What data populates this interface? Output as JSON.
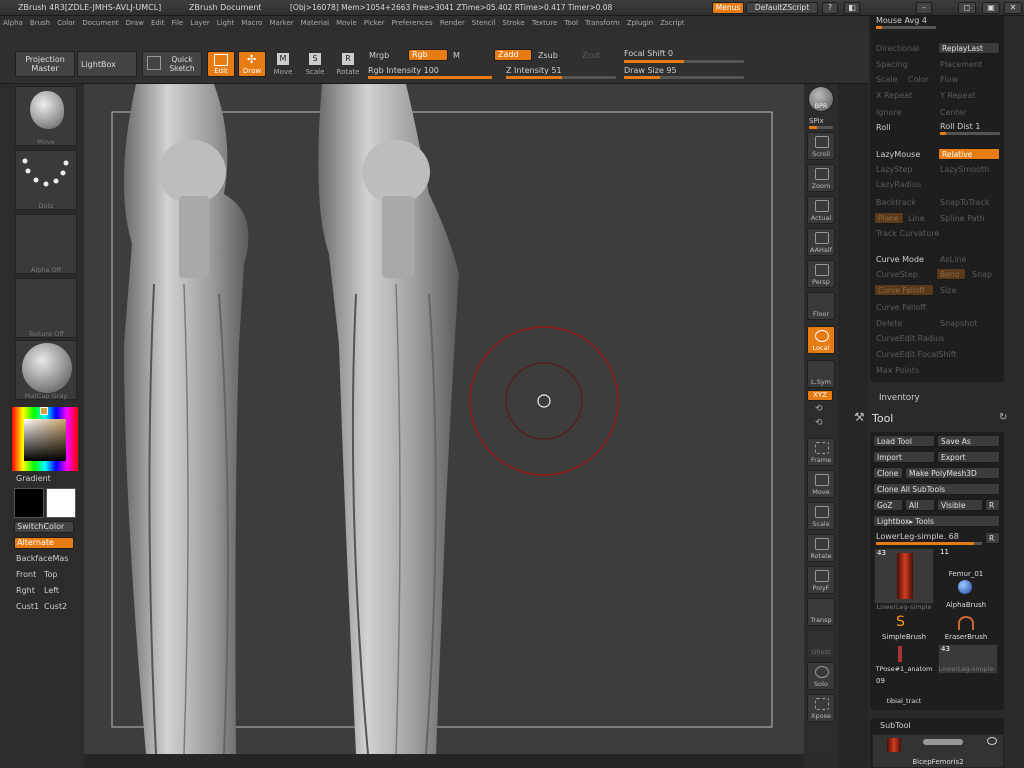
{
  "title": {
    "app": "ZBrush 4R3[ZDLE-JMHS-AVLJ-UMCL]",
    "document": "ZBrush Document",
    "stats": "[Obj>16078] Mem>1054+2663 Free>3041 ZTime>05.402 RTime>0.417 Timer>0.08",
    "menus_btn": "Menus",
    "script_btn": "DefaultZScript"
  },
  "menubar": [
    "Alpha",
    "Brush",
    "Color",
    "Document",
    "Draw",
    "Edit",
    "File",
    "Layer",
    "Light",
    "Macro",
    "Marker",
    "Material",
    "Movie",
    "Picker",
    "Preferences",
    "Render",
    "Stencil",
    "Stroke",
    "Texture",
    "Tool",
    "Transform",
    "Zplugin",
    "Zscript"
  ],
  "shelf": {
    "projection_master": "Projection Master",
    "lightbox": "LightBox",
    "quick_sketch": "Quick Sketch",
    "edit": "Edit",
    "draw": "Draw",
    "move": "Move",
    "scale": "Scale",
    "rotate": "Rotate",
    "mrgb": "Mrgb",
    "rgb": "Rgb",
    "m": "M",
    "zadd": "Zadd",
    "zsub": "Zsub",
    "zcut": "Zcut",
    "rgb_intensity": "Rgb Intensity 100",
    "z_intensity": "Z Intensity 51",
    "focal_shift": "Focal Shift 0",
    "draw_size": "Draw Size 95",
    "rgb_intensity_level": 1.0,
    "z_intensity_level": 0.51,
    "focal_shift_level": 0.5,
    "draw_size_level": 0.3
  },
  "left": {
    "brush": "Move",
    "stroke": "Dots",
    "alpha": "Alpha Off",
    "texture": "Texture Off",
    "material": "MatCap Gray",
    "gradient": "Gradient",
    "switchcolor": "SwitchColor",
    "alternate": "Alternate",
    "backface": "BackfaceMas",
    "front": "Front",
    "top": "Top",
    "rght": "Rght",
    "left": "Left",
    "cust1": "Cust1",
    "cust2": "Cust2"
  },
  "right_shelf": {
    "bpr": "BPR",
    "spix": "SPix",
    "scroll": "Scroll",
    "zoom": "Zoom",
    "actual": "Actual",
    "aahalf": "AAHalf",
    "persp": "Persp",
    "floor": "Floor",
    "local": "Local",
    "lsym": "L.Sym",
    "xyz": "XYZ",
    "frame": "Frame",
    "move": "Move",
    "scale": "Scale",
    "rotate": "Rotate",
    "polyf": "PolyF",
    "transp": "Transp",
    "ghost": "Ghost",
    "solo": "Solo",
    "xpose": "Xpose"
  },
  "stroke_panel": {
    "mouse_avg": "Mouse Avg 4",
    "directional": "Directional",
    "replaylast": "ReplayLast",
    "spacing": "Spacing",
    "placement": "Placement",
    "scale": "Scale",
    "color": "Color",
    "flow": "Flow",
    "x_repeat": "X Repeat",
    "y_repeat": "Y Repeat",
    "ignore": "Ignore",
    "center": "Center",
    "roll": "Roll",
    "roll_dist": "Roll Dist 1",
    "lazymouse": "LazyMouse",
    "relative": "Relative",
    "lazystep": "LazyStep",
    "lazysmooth": "LazySmooth",
    "lazyradius": "LazyRadius",
    "backtrack": "Backtrack",
    "snaptotrack": "SnapToTrack",
    "plane": "Plane",
    "line": "Line",
    "spline_path": "Spline Path",
    "track_curvature": "Track Curvature",
    "curve_mode": "Curve Mode",
    "as_line": "AsLine",
    "curve_step": "CurveStep",
    "bend": "Bend",
    "snap": "Snap",
    "curve_falloff_btn": "Curve Falloff",
    "size": "Size",
    "curve_falloff": "Curve Falloff",
    "delete": "Delete",
    "snapshot": "Snapshot",
    "curveedit_radius": "CurveEdit Radius",
    "curveedit_focalshift": "CurveEdit FocalShift",
    "max_points": "Max Points"
  },
  "inventory": "Inventory",
  "tool_panel": {
    "title": "Tool",
    "load_tool": "Load Tool",
    "save_as": "Save As",
    "import": "Import",
    "export": "Export",
    "clone": "Clone",
    "make_polymesh": "Make PolyMesh3D",
    "clone_all": "Clone All SubTools",
    "goz": "GoZ",
    "all": "All",
    "visible": "Visible",
    "r": "R",
    "lightbox_tools": "Lightbox▸ Tools",
    "current_tool": "LowerLeg-simple. 68",
    "tools": [
      {
        "name": "LowerLeg-simple",
        "count": "43"
      },
      {
        "name": "Femur_01",
        "count": "11"
      },
      {
        "name": "AlphaBrush",
        "count": ""
      },
      {
        "name": "SimpleBrush",
        "count": ""
      },
      {
        "name": "EraserBrush",
        "count": ""
      },
      {
        "name": "TPose#1_anatom",
        "count": ""
      },
      {
        "name": "LowerLeg-simple",
        "count": "43"
      },
      {
        "name": "tibial_tract",
        "count": "09"
      }
    ]
  },
  "subtool": {
    "title": "SubTool",
    "item": "BicepFemoris2"
  }
}
